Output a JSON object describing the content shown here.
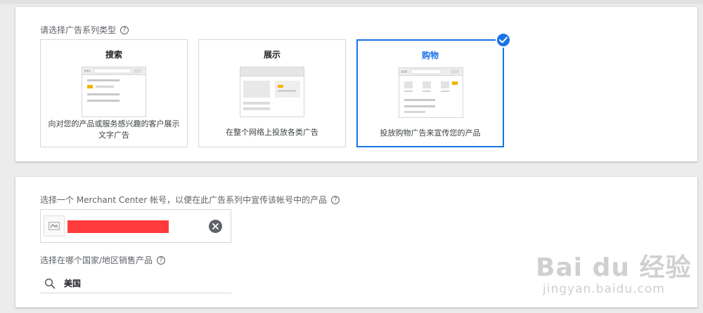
{
  "campaign_type": {
    "label": "请选择广告系列类型",
    "help_icon": "help-circle-icon",
    "cards": [
      {
        "id": "search",
        "title": "搜索",
        "description": "向对您的产品或服务感兴趣的客户展示文字广告",
        "selected": false
      },
      {
        "id": "display",
        "title": "展示",
        "description": "在整个网络上投放各类广告",
        "selected": false
      },
      {
        "id": "shopping",
        "title": "购物",
        "description": "投放购物广告来宣传您的产品",
        "selected": true
      }
    ],
    "selected_icon": "check-circle-icon"
  },
  "merchant": {
    "label": "选择一个 Merchant Center 帐号，以便在此广告系列中宣传该帐号中的产品",
    "help_icon": "help-circle-icon",
    "account_redacted": true,
    "clear_icon": "close-circle-icon"
  },
  "country": {
    "label": "选择在哪个国家/地区销售产品",
    "help_icon": "help-circle-icon",
    "search_icon": "search-icon",
    "value": "美国"
  },
  "watermark": {
    "main": "Bai du 经验",
    "sub": "jingyan.baidu.com"
  },
  "colors": {
    "accent": "#1a73e8",
    "redaction": "#ff3b3b",
    "illustration_yellow": "#f4b400"
  }
}
